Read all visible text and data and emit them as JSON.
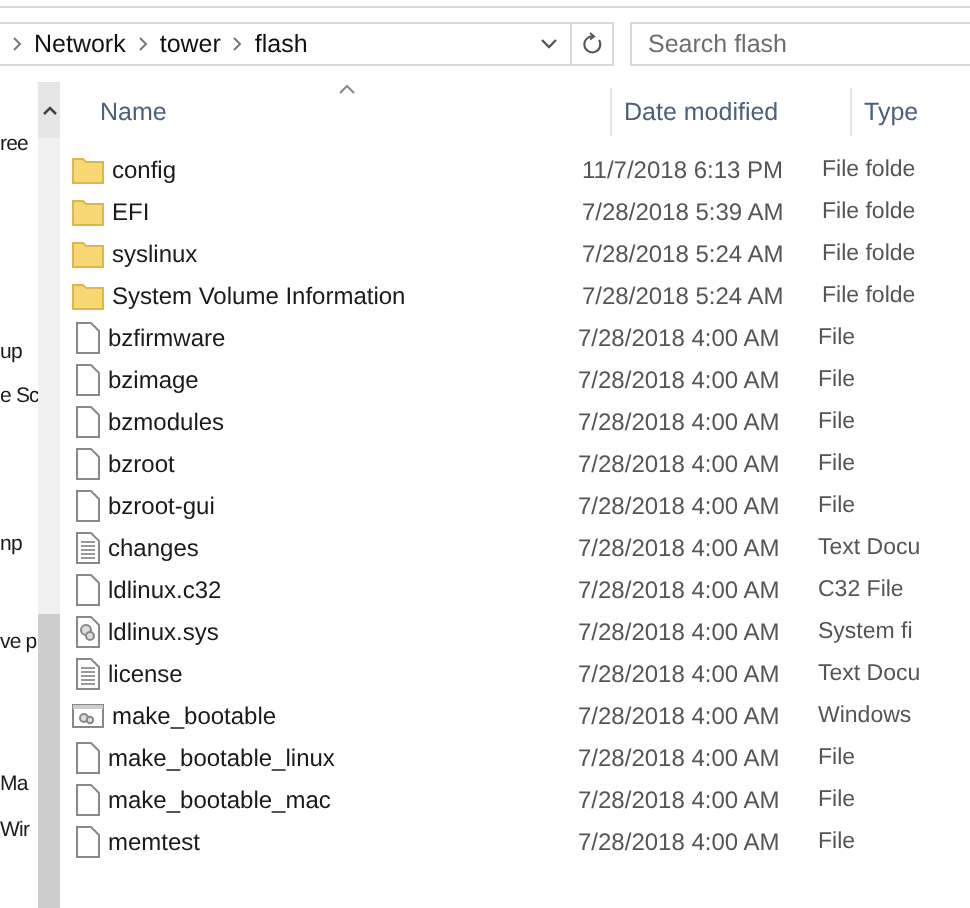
{
  "address_bar": {
    "path": [
      "Network",
      "tower",
      "flash"
    ]
  },
  "search": {
    "placeholder": "Search flash"
  },
  "nav_pane": {
    "items": [
      "ree",
      "up",
      "e Sc",
      "np",
      "ve p",
      "Ma",
      "Wir"
    ]
  },
  "table": {
    "columns": [
      "Name",
      "Date modified",
      "Type"
    ],
    "rows": [
      {
        "kind": "folder",
        "name": "config",
        "date": "11/7/2018 6:13 PM",
        "type": "File folde"
      },
      {
        "kind": "folder",
        "name": "EFI",
        "date": "7/28/2018 5:39 AM",
        "type": "File folde"
      },
      {
        "kind": "folder",
        "name": "syslinux",
        "date": "7/28/2018 5:24 AM",
        "type": "File folde"
      },
      {
        "kind": "folder",
        "name": "System Volume Information",
        "date": "7/28/2018 5:24 AM",
        "type": "File folde"
      },
      {
        "kind": "file",
        "name": "bzfirmware",
        "date": "7/28/2018 4:00 AM",
        "type": "File"
      },
      {
        "kind": "file",
        "name": "bzimage",
        "date": "7/28/2018 4:00 AM",
        "type": "File"
      },
      {
        "kind": "file",
        "name": "bzmodules",
        "date": "7/28/2018 4:00 AM",
        "type": "File"
      },
      {
        "kind": "file",
        "name": "bzroot",
        "date": "7/28/2018 4:00 AM",
        "type": "File"
      },
      {
        "kind": "file",
        "name": "bzroot-gui",
        "date": "7/28/2018 4:00 AM",
        "type": "File"
      },
      {
        "kind": "text",
        "name": "changes",
        "date": "7/28/2018 4:00 AM",
        "type": "Text Docu"
      },
      {
        "kind": "file",
        "name": "ldlinux.c32",
        "date": "7/28/2018 4:00 AM",
        "type": "C32 File"
      },
      {
        "kind": "system",
        "name": "ldlinux.sys",
        "date": "7/28/2018 4:00 AM",
        "type": "System fi"
      },
      {
        "kind": "text",
        "name": "license",
        "date": "7/28/2018 4:00 AM",
        "type": "Text Docu"
      },
      {
        "kind": "batch",
        "name": "make_bootable",
        "date": "7/28/2018 4:00 AM",
        "type": "Windows"
      },
      {
        "kind": "file",
        "name": "make_bootable_linux",
        "date": "7/28/2018 4:00 AM",
        "type": "File"
      },
      {
        "kind": "file",
        "name": "make_bootable_mac",
        "date": "7/28/2018 4:00 AM",
        "type": "File"
      },
      {
        "kind": "file",
        "name": "memtest",
        "date": "7/28/2018 4:00 AM",
        "type": "File"
      }
    ]
  }
}
